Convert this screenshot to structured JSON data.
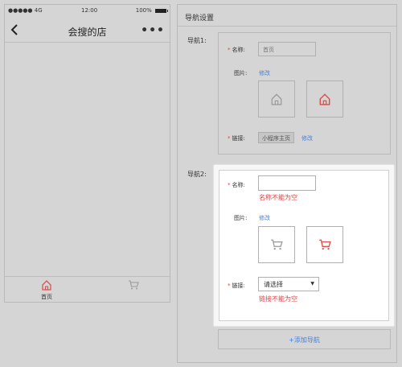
{
  "phone": {
    "status_carrier": "●●●●● 4G",
    "status_time": "12:00",
    "status_battery": "100%",
    "title": "会搜的店",
    "more": "•••",
    "tabs": [
      {
        "label": "首页",
        "icon": "home-icon"
      },
      {
        "label": "",
        "icon": "cart-icon"
      }
    ]
  },
  "panel": {
    "header": "导航设置",
    "nav1": {
      "label": "导航1:",
      "name_label": "名称:",
      "name_value": "首页",
      "image_label": "图片:",
      "image_edit": "修改",
      "link_label": "链接:",
      "link_value": "小程序主页",
      "link_edit": "修改"
    },
    "nav2": {
      "label": "导航2:",
      "name_label": "名称:",
      "name_value": "",
      "name_error": "名称不能为空",
      "image_label": "图片:",
      "image_edit": "修改",
      "link_label": "链接:",
      "link_select": "请选择",
      "link_error": "链接不能为空"
    },
    "add_nav": "+添加导航"
  },
  "colors": {
    "accent": "#4a7fd6",
    "error": "#e04343",
    "icon_active": "#d9534f",
    "icon_inactive": "#999999"
  }
}
